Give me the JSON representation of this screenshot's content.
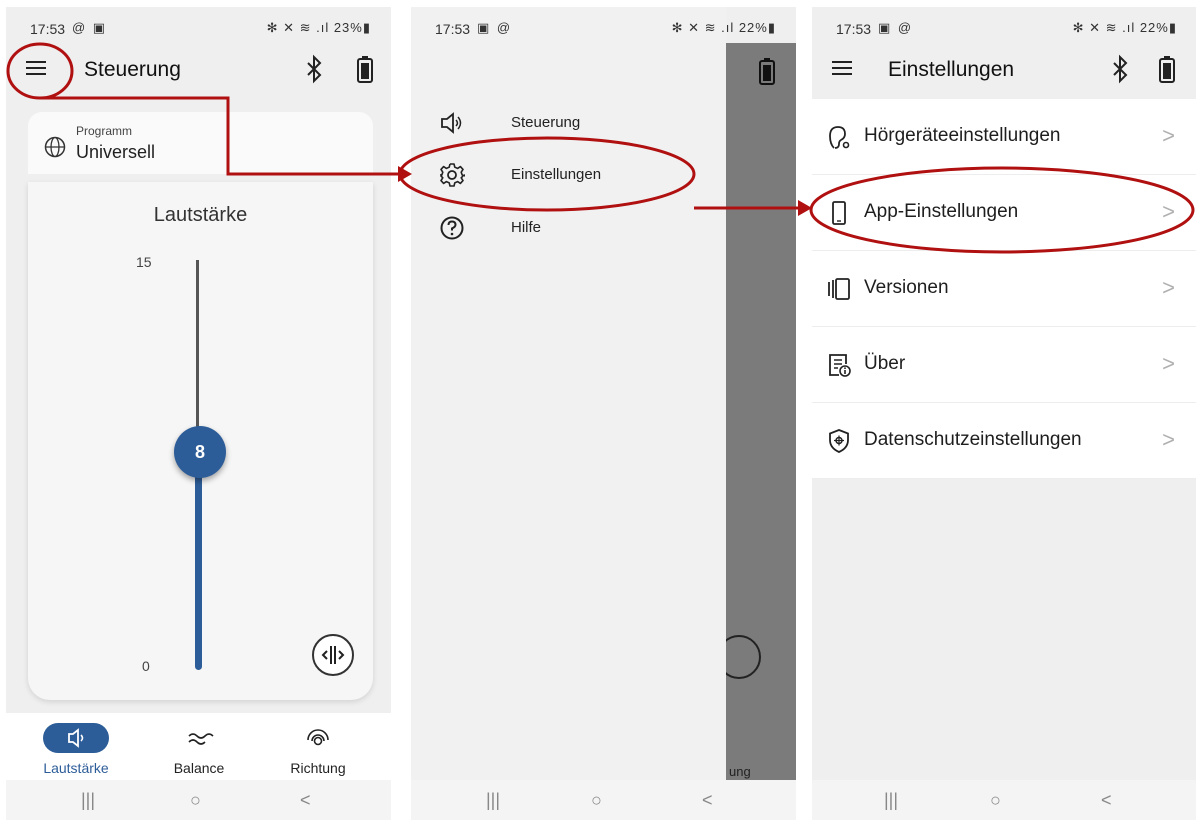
{
  "accent_color": "#2d5d98",
  "annotation_color": "#b01010",
  "phone1": {
    "status": {
      "time": "17:53",
      "left_icons": "@ ▣",
      "right": "✻ ✕ ≋ .ıl 23%▮"
    },
    "title": "Steuerung",
    "program_label": "Programm",
    "program_value": "Universell",
    "volume_title": "Lautstärke",
    "tick_max": "15",
    "tick_min": "0",
    "volume_value": "8",
    "nav": [
      {
        "label": "Lautstärke",
        "icon": "speaker-icon",
        "active": true
      },
      {
        "label": "Balance",
        "icon": "balance-icon",
        "active": false
      },
      {
        "label": "Richtung",
        "icon": "direction-icon",
        "active": false
      }
    ]
  },
  "phone2": {
    "status": {
      "time": "17:53",
      "left_icons": "▣ @",
      "right": "✻ ✕ ≋ .ıl 22%▮"
    },
    "menu": [
      {
        "label": "Steuerung",
        "icon": "speaker-icon"
      },
      {
        "label": "Einstellungen",
        "icon": "gear-icon"
      },
      {
        "label": "Hilfe",
        "icon": "help-icon"
      }
    ],
    "ghost_text": "ung"
  },
  "phone3": {
    "status": {
      "time": "17:53",
      "left_icons": "▣ @",
      "right": "✻ ✕ ≋ .ıl 22%▮"
    },
    "title": "Einstellungen",
    "items": [
      {
        "label": "Hörgeräteeinstellungen",
        "icon": "ear-icon"
      },
      {
        "label": "App-Einstellungen",
        "icon": "phone-icon"
      },
      {
        "label": "Versionen",
        "icon": "versions-icon"
      },
      {
        "label": "Über",
        "icon": "info-document-icon"
      },
      {
        "label": "Datenschutzeinstellungen",
        "icon": "shield-icon"
      }
    ],
    "chevron": ">"
  },
  "sysnav": {
    "recent": "|||",
    "home": "○",
    "back": "<"
  }
}
